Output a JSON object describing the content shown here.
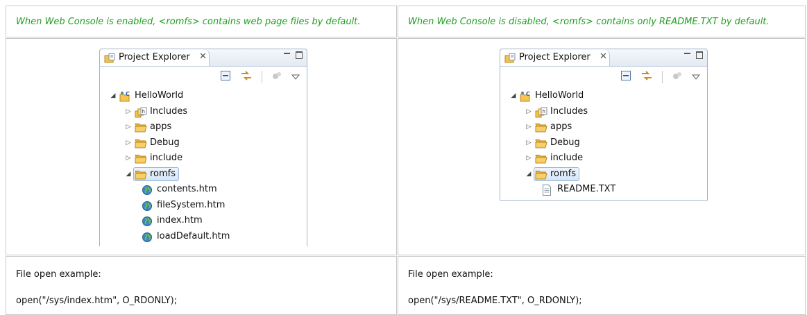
{
  "left": {
    "caption": "When Web Console is enabled, <romfs> contains web page files by default.",
    "panel": {
      "title": "Project Explorer",
      "close": "✕",
      "tree": [
        {
          "label": "HelloWorld",
          "icon": "project-icon",
          "expanded": true,
          "level": 0
        },
        {
          "label": "Includes",
          "icon": "includes-icon",
          "expanded": false,
          "level": 1
        },
        {
          "label": "apps",
          "icon": "folder-icon",
          "expanded": false,
          "level": 1
        },
        {
          "label": "Debug",
          "icon": "folder-icon",
          "expanded": false,
          "level": 1
        },
        {
          "label": "include",
          "icon": "folder-icon",
          "expanded": false,
          "level": 1
        },
        {
          "label": "romfs",
          "icon": "folder-icon",
          "expanded": true,
          "level": 1,
          "selected": true
        },
        {
          "label": "contents.htm",
          "icon": "globe-icon",
          "level": 2
        },
        {
          "label": "fileSystem.htm",
          "icon": "globe-icon",
          "level": 2
        },
        {
          "label": "index.htm",
          "icon": "globe-icon",
          "level": 2
        },
        {
          "label": "loadDefault.htm",
          "icon": "globe-icon",
          "level": 2
        }
      ]
    },
    "example_title": "File open example:",
    "example_code": "open(\"/sys/index.htm\", O_RDONLY);"
  },
  "right": {
    "caption": "When Web Console is disabled, <romfs> contains only README.TXT by default.",
    "panel": {
      "title": "Project Explorer",
      "close": "✕",
      "tree": [
        {
          "label": "HelloWorld",
          "icon": "project-icon",
          "expanded": true,
          "level": 0
        },
        {
          "label": "Includes",
          "icon": "includes-icon",
          "expanded": false,
          "level": 1
        },
        {
          "label": "apps",
          "icon": "folder-icon",
          "expanded": false,
          "level": 1
        },
        {
          "label": "Debug",
          "icon": "folder-icon",
          "expanded": false,
          "level": 1
        },
        {
          "label": "include",
          "icon": "folder-icon",
          "expanded": false,
          "level": 1
        },
        {
          "label": "romfs",
          "icon": "folder-icon",
          "expanded": true,
          "level": 1,
          "selected": true
        },
        {
          "label": "README.TXT",
          "icon": "text-file-icon",
          "level": 2
        }
      ]
    },
    "example_title": "File open example:",
    "example_code": "open(\"/sys/README.TXT\", O_RDONLY);"
  },
  "colors": {
    "caption": "#20a020",
    "border": "#c8c8c8",
    "selection": "#d6e6f8",
    "folder": "#f5c451"
  }
}
